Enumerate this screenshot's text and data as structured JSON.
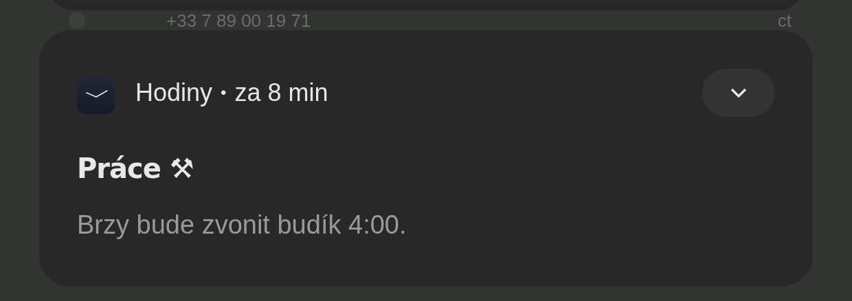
{
  "background_notification": {
    "phone_number": "+33 7 89 00 19 71",
    "trailing_text": "ct"
  },
  "notification": {
    "app_name": "Hodiny",
    "separator": "•",
    "time": "za 8 min",
    "expanded": false,
    "title": "Práce ⚒",
    "body": "Brzy bude zvonit budík 4:00."
  }
}
